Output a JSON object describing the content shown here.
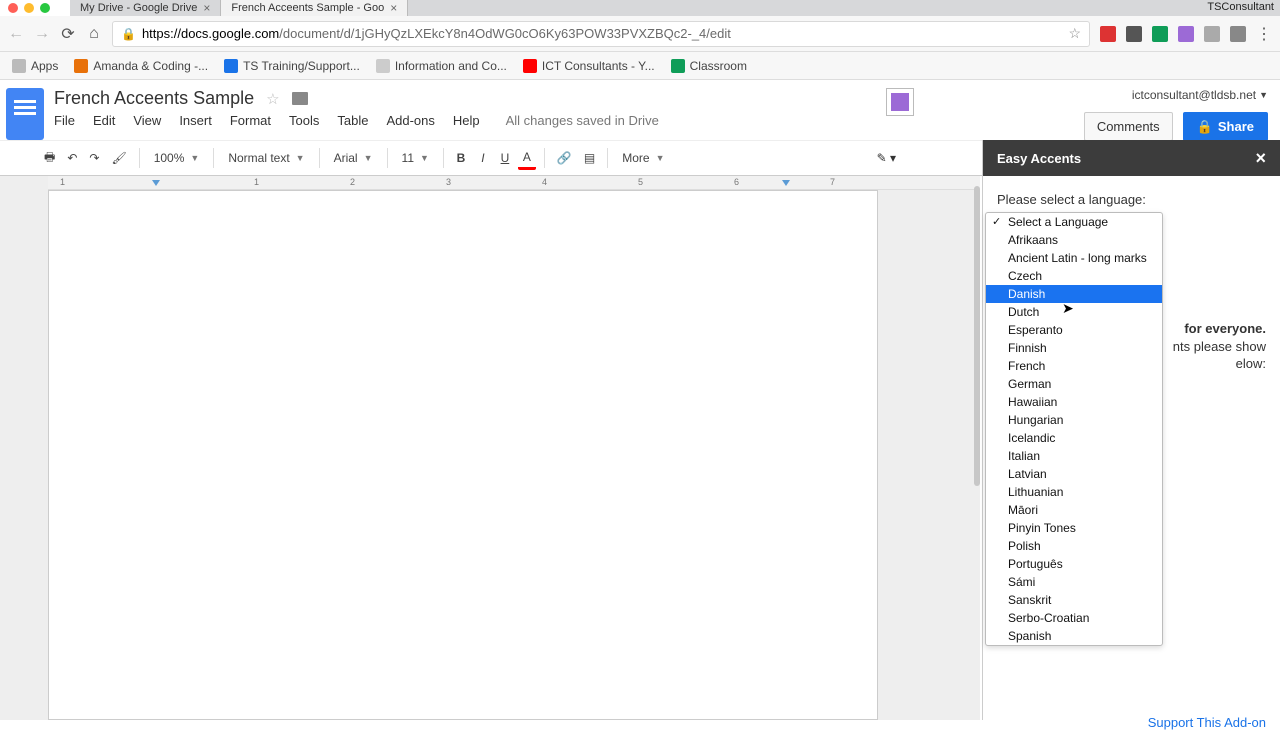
{
  "browser": {
    "profile": "TSConsultant",
    "tabs": [
      {
        "title": "My Drive - Google Drive",
        "active": false
      },
      {
        "title": "French Acceents Sample - Goo",
        "active": true
      }
    ],
    "url_host": "https://docs.google.com",
    "url_path": "/document/d/1jGHyQzLXEkcY8n4OdWG0cO6Ky63POW33PVXZBQc2-_4/edit",
    "bookmarks": [
      {
        "label": "Apps"
      },
      {
        "label": "Amanda & Coding -..."
      },
      {
        "label": "TS Training/Support..."
      },
      {
        "label": "Information and Co..."
      },
      {
        "label": "ICT Consultants - Y..."
      },
      {
        "label": "Classroom"
      }
    ]
  },
  "docs": {
    "title": "French Acceents Sample",
    "account": "ictconsultant@tldsb.net",
    "menus": [
      "File",
      "Edit",
      "View",
      "Insert",
      "Format",
      "Tools",
      "Table",
      "Add-ons",
      "Help"
    ],
    "saved_status": "All changes saved in Drive",
    "comments_btn": "Comments",
    "share_btn": "Share"
  },
  "toolbar": {
    "zoom": "100%",
    "style": "Normal text",
    "font": "Arial",
    "size": "11",
    "more": "More"
  },
  "ruler_marks": [
    "1",
    "1",
    "2",
    "3",
    "4",
    "5",
    "6",
    "7",
    "7"
  ],
  "sidebar": {
    "title": "Easy Accents",
    "prompt": "Please select a language:",
    "info_bold": "for everyone.",
    "info_line2": "nts please show",
    "info_line3": "elow:",
    "support": "Support This Add-on"
  },
  "dropdown": {
    "selected": "Select a Language",
    "highlight": "Danish",
    "items": [
      "Select a Language",
      "Afrikaans",
      "Ancient Latin - long marks",
      "Czech",
      "Danish",
      "Dutch",
      "Esperanto",
      "Finnish",
      "French",
      "German",
      "Hawaiian",
      "Hungarian",
      "Icelandic",
      "Italian",
      "Latvian",
      "Lithuanian",
      "Māori",
      "Pinyin Tones",
      "Polish",
      "Português",
      "Sámi",
      "Sanskrit",
      "Serbo-Croatian",
      "Spanish"
    ]
  }
}
